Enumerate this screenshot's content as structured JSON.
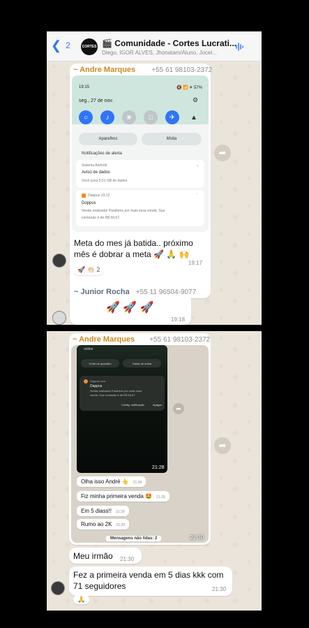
{
  "header": {
    "back_count": "2",
    "avatar_text": "CORTES",
    "group_icon": "🎬",
    "title": "Comunidade - Cortes Lucrati...",
    "members": "Diego, IGOR ALVES, Jhonatam/Aluno, Jocel..."
  },
  "msg1": {
    "sender": "~ Andre Marques",
    "phone": "+55 61 98103-2372",
    "text_line1": "Meta do mes já batida.. próximo",
    "text_line2": "mês é dobrar a meta 🚀 🙏 🙌",
    "time": "19:17",
    "reactions": "🚀 👏🏻 2",
    "screenshot": {
      "clock": "19:15",
      "status": "🔇 📶 ✈ 57%",
      "date": "seg., 27 de nov.",
      "tile1": "Aparelhos",
      "tile2": "Mídia",
      "section": "Notificações de alerta",
      "n1_app": "Sistema Android",
      "n1_title": "Aviso de dados",
      "n1_body": "Você usou 5,51 GB de dados.",
      "n2_app": "Dappus  19:12",
      "n2_title": "Doppus",
      "n2_body1": "Venda realizada! Parabéns por mais essa venda. Sua",
      "n2_body2": "comissão é de R$ 50,67."
    }
  },
  "msg2": {
    "sender": "~ Junior Rocha",
    "phone": "+55 11 96504-9077",
    "text": "🚀 🚀 🚀",
    "time": "19:18"
  },
  "msg3": {
    "sender": "~ Andre Marques",
    "phone": "+55 61 98103-2372",
    "time": "21:30",
    "screenshot": {
      "online": "online",
      "btn1": "Corte do quandho",
      "btn2": "Saída de mídia",
      "n_app": "Dappus  now",
      "n_title": "Dappus",
      "n_body1": "Venda realizada! Parabéns por mais essa",
      "n_body2": "venda. Sua comissão é de R$ 50,67",
      "n_action1": "Config. notificação",
      "n_action2": "Apagar",
      "time": "21:28"
    },
    "inner": [
      {
        "text": "Olha isso André 👆",
        "time": "21:28"
      },
      {
        "text": "Fiz minha primeira venda 🤩",
        "time": "21:29"
      },
      {
        "text": "Em 5 diass!!",
        "time": "21:29"
      },
      {
        "text": "Rumo ao 2K",
        "time": "21:29"
      }
    ],
    "unread": "Mensagens não lidas: 2",
    "inner_time": "21:30"
  },
  "msg4": {
    "text": "Meu irmão",
    "time": "21:30"
  },
  "msg5": {
    "text_line1": "Fez a primeira venda em 5 dias kkk com",
    "text_line2": "71 seguidores",
    "time": "21:30",
    "reaction": "🙏"
  }
}
